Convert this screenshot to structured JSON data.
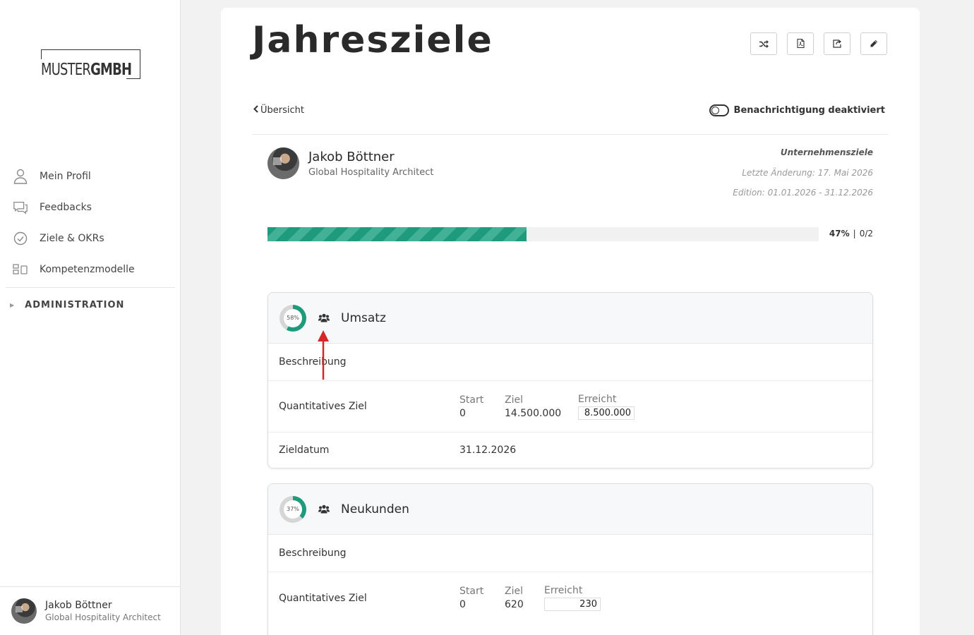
{
  "sidebar": {
    "logo": {
      "part1": "MUSTER",
      "part2": "GMBH"
    },
    "items": [
      {
        "label": "Mein Profil",
        "icon": "user-icon"
      },
      {
        "label": "Feedbacks",
        "icon": "chat-icon"
      },
      {
        "label": "Ziele & OKRs",
        "icon": "check-circle-icon"
      },
      {
        "label": "Kompetenzmodelle",
        "icon": "grid-icon"
      }
    ],
    "admin_label": "ADMINISTRATION",
    "user": {
      "name": "Jakob Böttner",
      "role": "Global Hospitality Architect"
    }
  },
  "page": {
    "title": "Jahresziele",
    "toolbar": [
      "shuffle-icon",
      "pdf-icon",
      "share-icon",
      "edit-icon"
    ],
    "back_label": "Übersicht",
    "notification_label": "Benachrichtigung deaktiviert",
    "owner": {
      "name": "Jakob Böttner",
      "role": "Global Hospitality Architect"
    },
    "meta": {
      "type": "Unternehmensziele",
      "last_change": "Letzte Änderung: 17. Mai 2026",
      "edition": "Edition: 01.01.2026 - 31.12.2026"
    },
    "progress": {
      "percent_value": 47,
      "percent_label": "47%",
      "separator": "|",
      "count": "0/2"
    }
  },
  "goals": [
    {
      "percent_value": 58,
      "percent_label": "58%",
      "title": "Umsatz",
      "description_label": "Beschreibung",
      "quant_label": "Quantitatives Ziel",
      "start_label": "Start",
      "start_value": "0",
      "target_label": "Ziel",
      "target_value": "14.500.000",
      "achieved_label": "Erreicht",
      "achieved_value": "8.500.000",
      "date_label": "Zieldatum",
      "date_value": "31.12.2026"
    },
    {
      "percent_value": 37,
      "percent_label": "37%",
      "title": "Neukunden",
      "description_label": "Beschreibung",
      "quant_label": "Quantitatives Ziel",
      "start_label": "Start",
      "start_value": "0",
      "target_label": "Ziel",
      "target_value": "620",
      "achieved_label": "Erreicht",
      "achieved_value": "230"
    }
  ],
  "colors": {
    "accent": "#1f9a7d",
    "accent_light": "#43b196",
    "annotation_arrow": "#d62828"
  }
}
